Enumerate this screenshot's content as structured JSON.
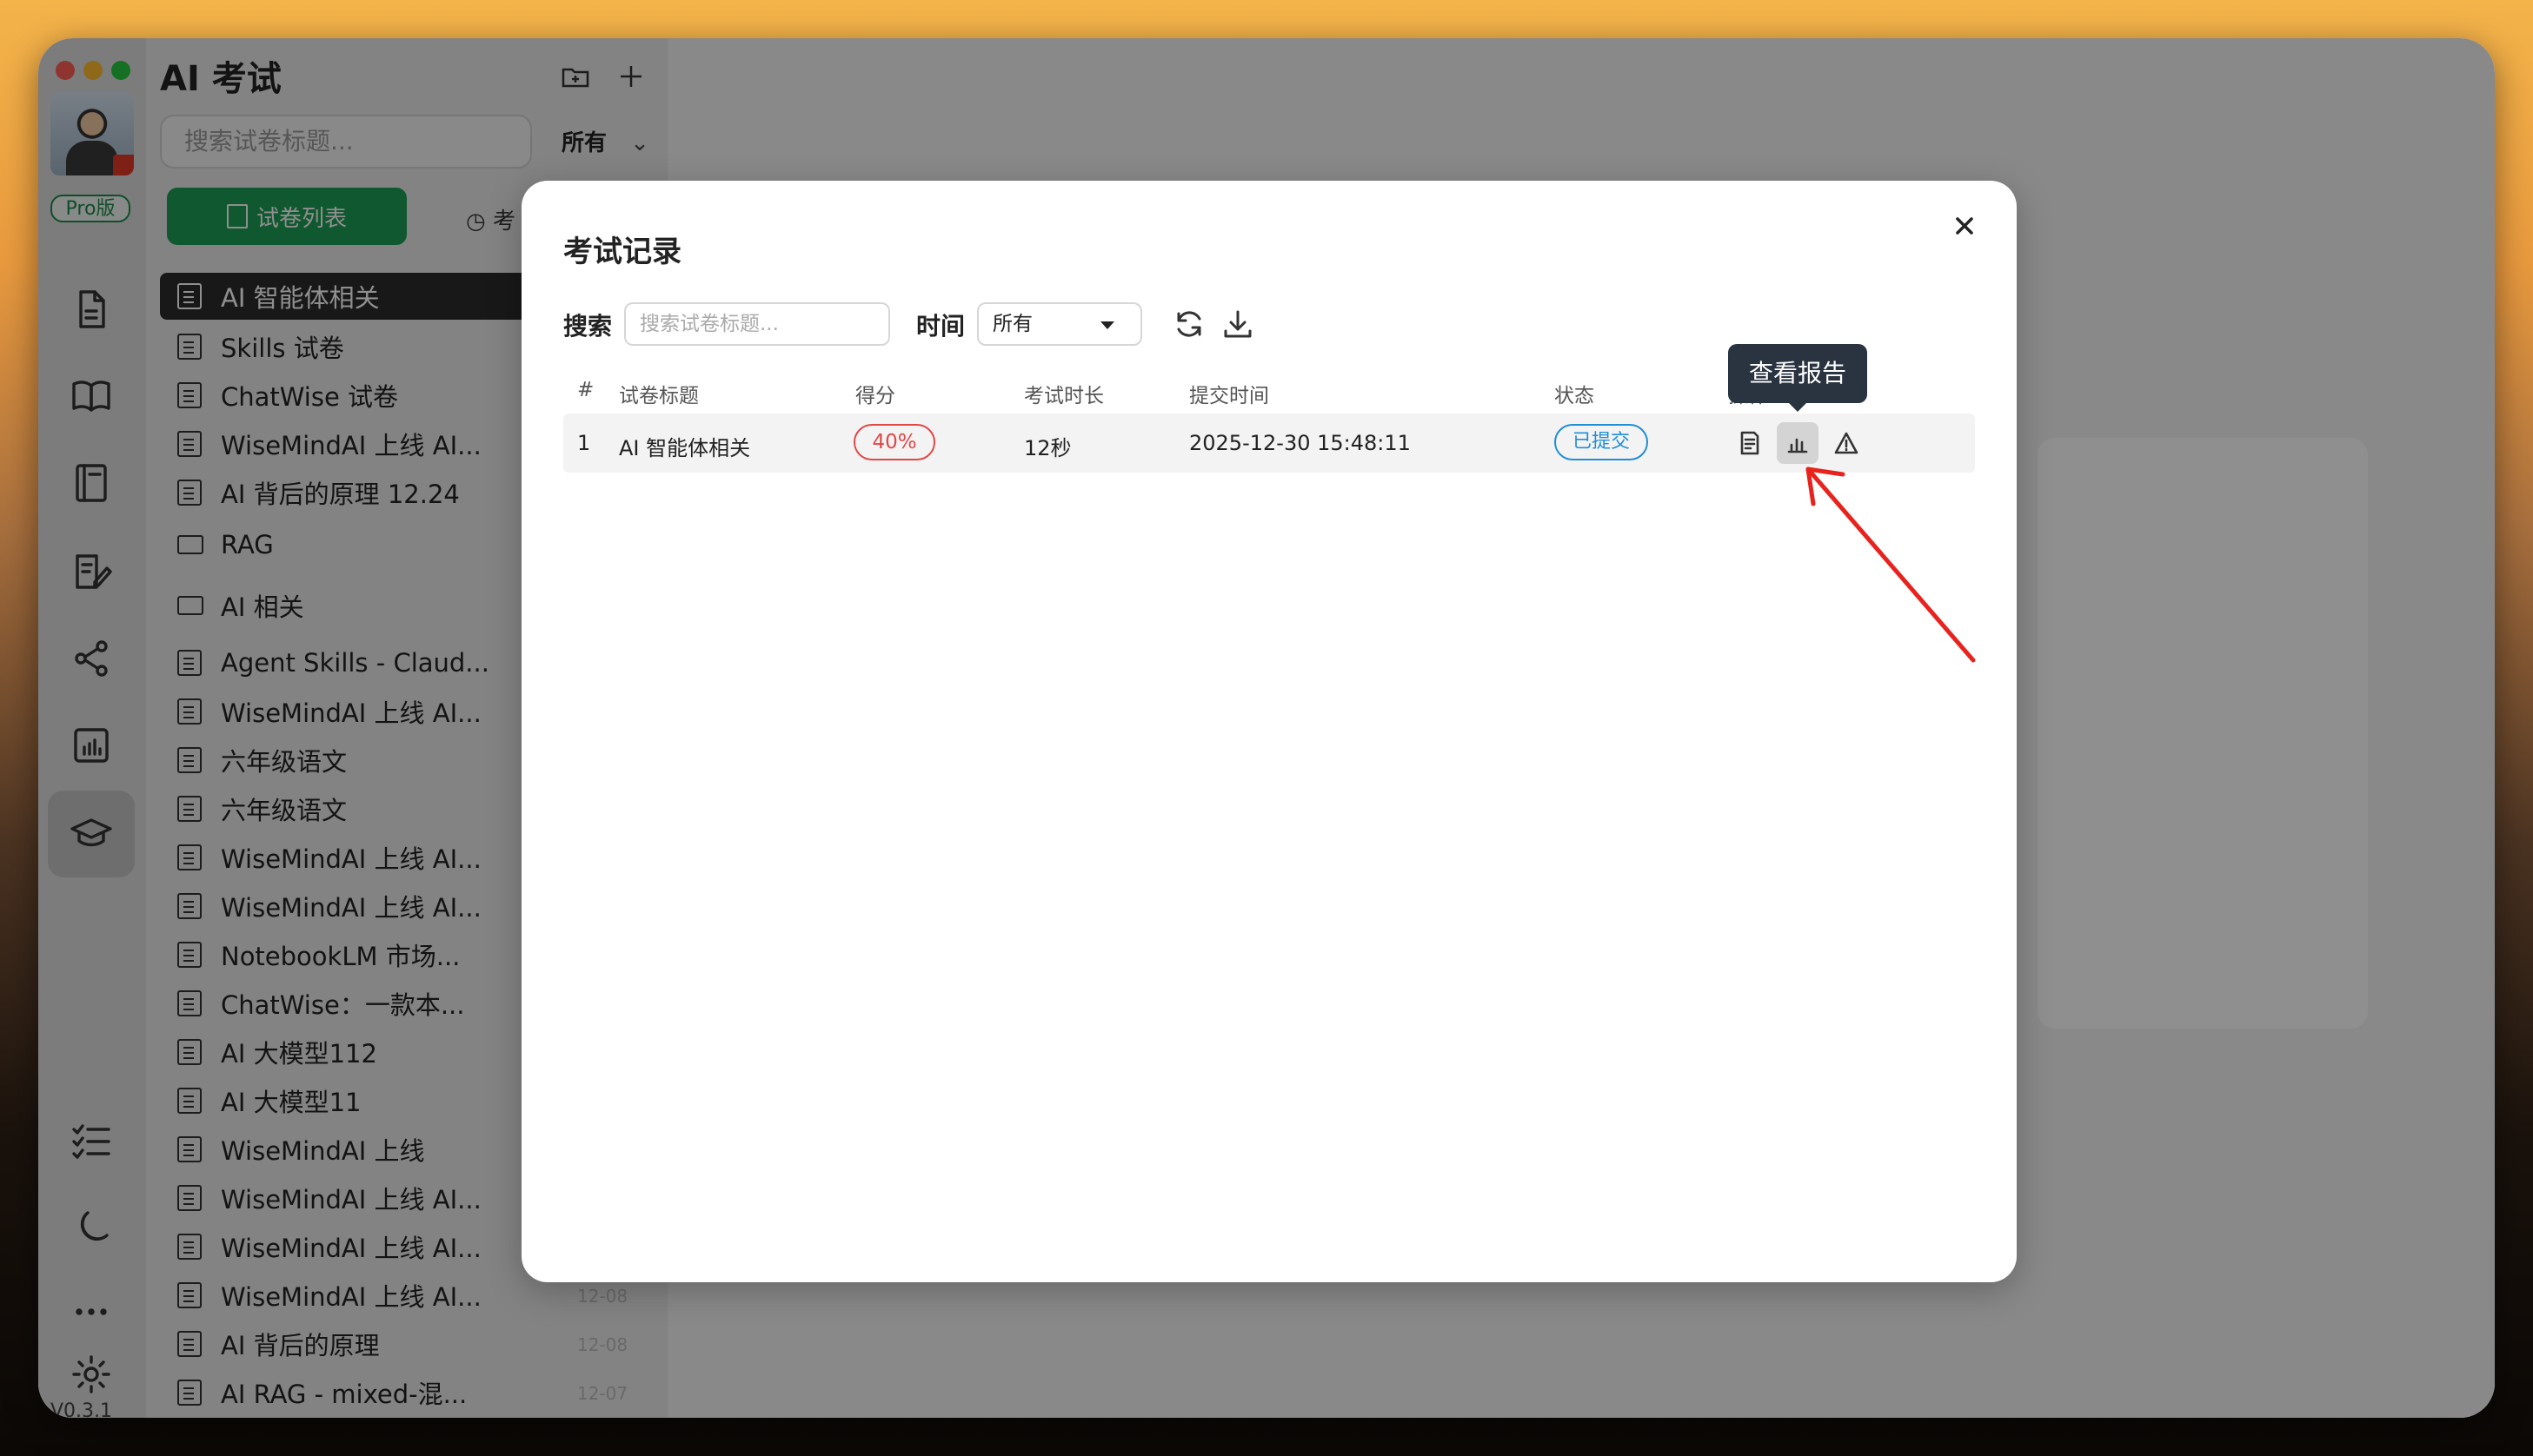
{
  "app": {
    "title": "AI 考试",
    "version": "V0.3.1",
    "pro_badge": "Pro版"
  },
  "sidebar": {
    "search_placeholder": "搜索试卷标题...",
    "filter_label": "所有",
    "tabs": [
      {
        "label": "试卷列表"
      },
      {
        "label": "考"
      }
    ],
    "items": [
      {
        "label": "AI 智能体相关",
        "type": "doc"
      },
      {
        "label": "Skills 试卷",
        "type": "doc"
      },
      {
        "label": "ChatWise 试卷",
        "type": "doc"
      },
      {
        "label": "WiseMindAI 上线 AI...",
        "type": "doc"
      },
      {
        "label": "AI 背后的原理 12.24",
        "type": "doc"
      },
      {
        "label": "RAG",
        "type": "folder"
      },
      {
        "label": "AI 相关",
        "type": "folder"
      },
      {
        "label": "Agent Skills - Claud...",
        "type": "doc"
      },
      {
        "label": "WiseMindAI 上线 AI...",
        "type": "doc"
      },
      {
        "label": "六年级语文",
        "type": "doc"
      },
      {
        "label": "六年级语文",
        "type": "doc"
      },
      {
        "label": "WiseMindAI 上线 AI...",
        "type": "doc"
      },
      {
        "label": "WiseMindAI 上线 AI...",
        "type": "doc"
      },
      {
        "label": "NotebookLM 市场...",
        "type": "doc"
      },
      {
        "label": "ChatWise：一款本...",
        "type": "doc"
      },
      {
        "label": "AI 大模型112",
        "type": "doc"
      },
      {
        "label": "AI 大模型11",
        "type": "doc"
      },
      {
        "label": "WiseMindAI 上线",
        "type": "doc"
      },
      {
        "label": "WiseMindAI 上线 AI...",
        "type": "doc"
      },
      {
        "label": "WiseMindAI 上线 AI...",
        "type": "doc"
      },
      {
        "label": "WiseMindAI 上线 AI...",
        "type": "doc",
        "date": "12-08"
      },
      {
        "label": "AI 背后的原理",
        "type": "doc",
        "date": "12-08"
      },
      {
        "label": "AI RAG - mixed-混...",
        "type": "doc",
        "date": "12-07"
      }
    ]
  },
  "modal": {
    "title": "考试记录",
    "search_label": "搜索",
    "search_placeholder": "搜索试卷标题...",
    "time_label": "时间",
    "time_value": "所有",
    "columns": [
      "#",
      "试卷标题",
      "得分",
      "考试时长",
      "提交时间",
      "状态",
      "操作"
    ],
    "rows": [
      {
        "index": "1",
        "title": "AI 智能体相关",
        "score": "40%",
        "duration": "12秒",
        "submitted": "2025-12-30 15:48:11",
        "status": "已提交"
      }
    ],
    "tooltip": "查看报告"
  },
  "colors": {
    "accent_green": "#1e9e55",
    "score_red": "#e04848",
    "status_blue": "#1f8fd6",
    "annotation_arrow": "#e8231e"
  }
}
